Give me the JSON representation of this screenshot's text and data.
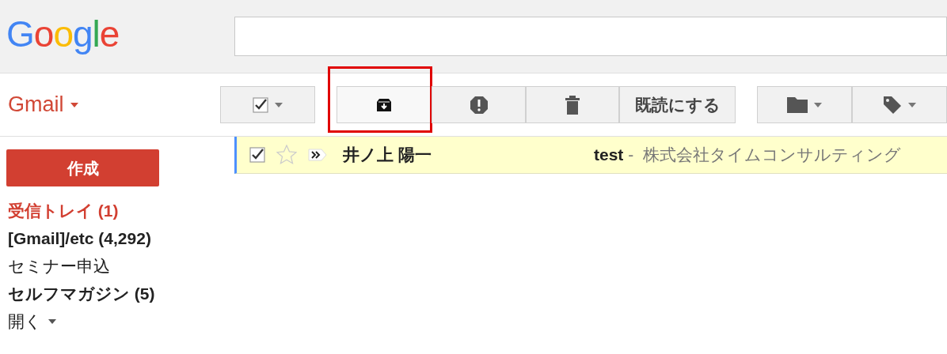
{
  "logo": "Google",
  "app_menu": {
    "label": "Gmail"
  },
  "compose": {
    "label": "作成"
  },
  "toolbar": [
    {
      "kind": "select",
      "checked": true,
      "highlighted": false
    },
    {
      "kind": "archive",
      "highlighted": true
    },
    {
      "kind": "spam",
      "highlighted": false
    },
    {
      "kind": "delete",
      "highlighted": false
    },
    {
      "kind": "text",
      "label": "既読にする",
      "highlighted": false
    },
    {
      "kind": "move",
      "highlighted": false
    },
    {
      "kind": "labels",
      "highlighted": false
    }
  ],
  "sidebar": {
    "items": [
      {
        "label": "受信トレイ (1)",
        "selected": true,
        "unread": true
      },
      {
        "label": "[Gmail]/etc (4,292)",
        "selected": false,
        "unread": true
      },
      {
        "label": "セミナー申込",
        "selected": false,
        "unread": false
      },
      {
        "label": "セルフマガジン (5)",
        "selected": false,
        "unread": true
      }
    ],
    "more": {
      "label": "開く"
    }
  },
  "messages": [
    {
      "checked": true,
      "starred": false,
      "important": false,
      "sender": "井ノ上 陽一",
      "subject": "test",
      "separator": "-",
      "snippet": "株式会社タイムコンサルティング"
    }
  ]
}
